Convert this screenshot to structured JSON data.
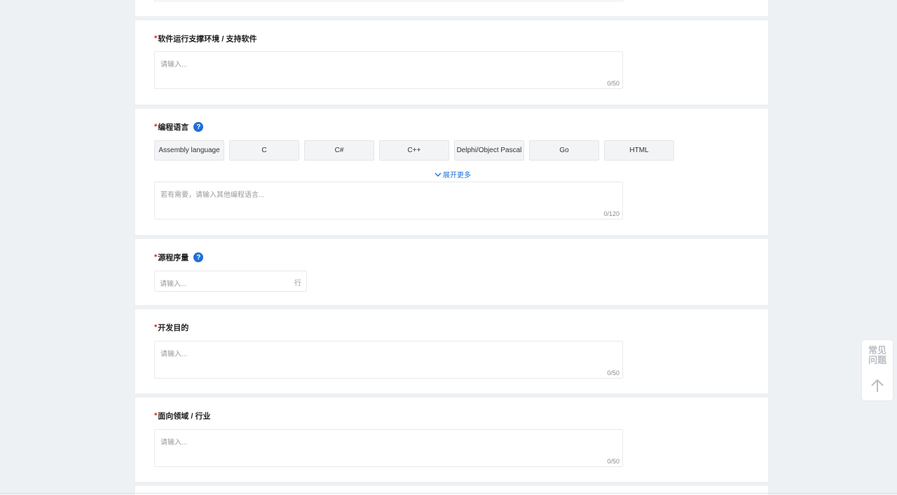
{
  "sections": {
    "env": {
      "required_mark": "*",
      "label": "软件运行支撑环境 / 支持软件",
      "placeholder": "请输入...",
      "count": "0/50"
    },
    "lang": {
      "required_mark": "*",
      "label": "编程语言",
      "help": "?",
      "chips": [
        "Assembly language",
        "C",
        "C#",
        "C++",
        "Delphi/Object Pascal",
        "Go",
        "HTML"
      ],
      "expand_label": "展开更多",
      "placeholder": "若有需要，请输入其他编程语言...",
      "count": "0/120"
    },
    "loc": {
      "required_mark": "*",
      "label": "源程序量",
      "help": "?",
      "placeholder": "请输入...",
      "unit": "行"
    },
    "purpose": {
      "required_mark": "*",
      "label": "开发目的",
      "placeholder": "请输入...",
      "count": "0/50"
    },
    "domain": {
      "required_mark": "*",
      "label": "面向领域 / 行业",
      "placeholder": "请输入...",
      "count": "0/50"
    }
  },
  "float": {
    "faq_line1": "常见",
    "faq_line2": "问题",
    "up_icon": "arrow-up-icon"
  },
  "colors": {
    "accent": "#1f6fd6",
    "required": "#e02020",
    "background": "#eef1f4"
  }
}
